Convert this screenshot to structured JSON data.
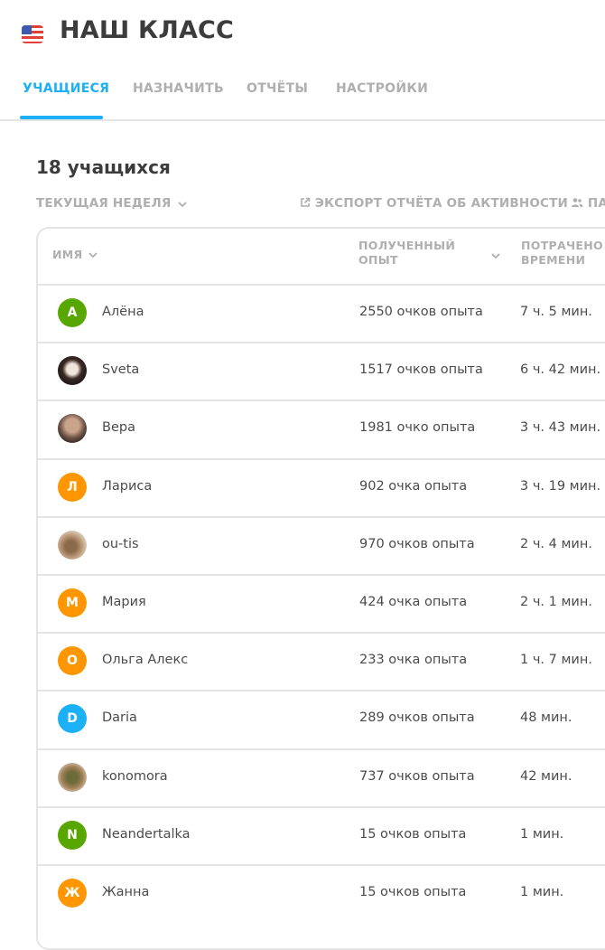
{
  "header": {
    "title": "НАШ КЛАСС",
    "tabs": [
      {
        "label": "УЧАЩИЕСЯ",
        "active": true
      },
      {
        "label": "НАЗНАЧИТЬ",
        "active": false
      },
      {
        "label": "ОТЧЁТЫ",
        "active": false
      },
      {
        "label": "НАСТРОЙКИ",
        "active": false
      }
    ]
  },
  "students": {
    "count_label": "18 учащихся",
    "period_filter": "ТЕКУЩАЯ НЕДЕЛЯ",
    "export_label": "ЭКСПОРТ ОТЧЁТА ОБ АКТИВНОСТИ",
    "partial_action_label": "ПА"
  },
  "table": {
    "columns": {
      "name": "ИМЯ",
      "xp_line1": "ПОЛУЧЕННЫЙ",
      "xp_line2": "ОПЫТ",
      "time_line1": "ПОТРАЧЕНО",
      "time_line2": "ВРЕМЕНИ"
    },
    "rows": [
      {
        "avatar": "А",
        "avatar_color": "#58a700",
        "name": "Алёна",
        "xp": "2550 очков опыта",
        "time": "7 ч. 5 мин."
      },
      {
        "avatar": "",
        "avatar_color": "photo4",
        "name": "Sveta",
        "xp": "1517 очков опыта",
        "time": "6 ч. 42 мин."
      },
      {
        "avatar": "",
        "avatar_color": "photo",
        "name": "Вера",
        "xp": "1981 очко опыта",
        "time": "3 ч. 43 мин."
      },
      {
        "avatar": "Л",
        "avatar_color": "#ff9600",
        "name": "Лариса",
        "xp": "902 очка опыта",
        "time": "3 ч. 19 мин."
      },
      {
        "avatar": "",
        "avatar_color": "photo2",
        "name": "ou-tis",
        "xp": "970 очков опыта",
        "time": "2 ч. 4 мин."
      },
      {
        "avatar": "М",
        "avatar_color": "#ff9600",
        "name": "Мария",
        "xp": "424 очка опыта",
        "time": "2 ч. 1 мин."
      },
      {
        "avatar": "О",
        "avatar_color": "#ff9600",
        "name": "Ольга Алекс",
        "xp": "233 очка опыта",
        "time": "1 ч. 7 мин."
      },
      {
        "avatar": "D",
        "avatar_color": "#1cb0f6",
        "name": "Daria",
        "xp": "289 очков опыта",
        "time": "48 мин."
      },
      {
        "avatar": "",
        "avatar_color": "photo3",
        "name": "konomora",
        "xp": "737 очков опыта",
        "time": "42 мин."
      },
      {
        "avatar": "N",
        "avatar_color": "#58a700",
        "name": "Neandertalka",
        "xp": "15 очков опыта",
        "time": "1 мин."
      },
      {
        "avatar": "Ж",
        "avatar_color": "#ff9600",
        "name": "Жанна",
        "xp": "15 очков опыта",
        "time": "1 мин."
      }
    ]
  },
  "colors": {
    "accent": "#1cb0f6",
    "muted": "#afafaf",
    "border": "#e5e5e5",
    "text": "#4b4b4b"
  }
}
